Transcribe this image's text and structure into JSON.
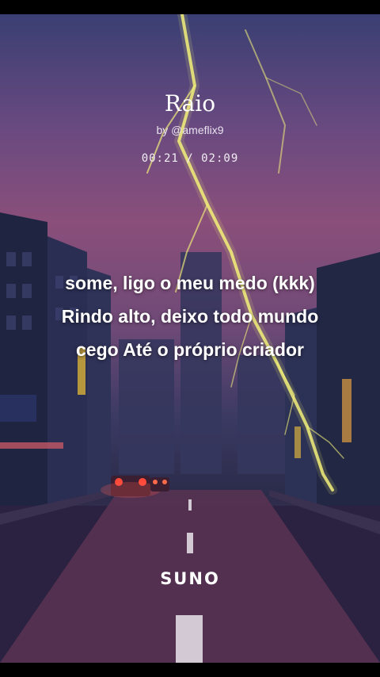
{
  "song": {
    "title": "Raio",
    "byline": "by @ameflix9",
    "time": "00:21 / 02:09"
  },
  "lyrics": [
    "some, ligo o meu medo (kkk)",
    "Rindo alto, deixo todo mundo",
    "cego Até o próprio criador"
  ],
  "brand": {
    "logo": "SUNO"
  },
  "colors": {
    "text": "#ffffff",
    "lightning": "#f3f07a",
    "tail_light": "#ff4a3a"
  }
}
